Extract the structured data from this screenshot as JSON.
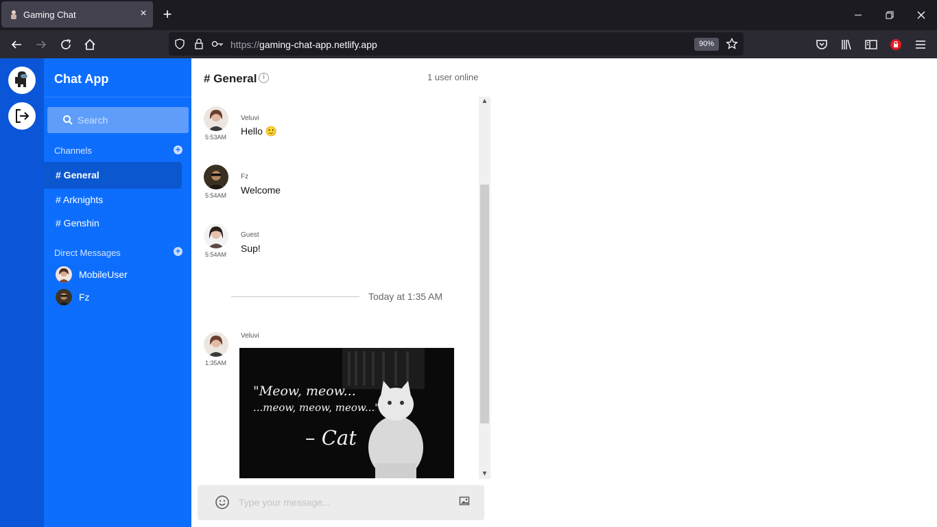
{
  "browser": {
    "tab_title": "Gaming Chat",
    "url_protocol": "https://",
    "url_host": "gaming-chat-app.netlify.app",
    "zoom": "90%"
  },
  "app": {
    "brand": "Chat App",
    "search_placeholder": "Search",
    "channels_title": "Channels",
    "channels": [
      "# General",
      "# Arknights",
      "# Genshin"
    ],
    "active_channel": "# General",
    "dm_title": "Direct Messages",
    "dms": [
      "MobileUser",
      "Fz"
    ]
  },
  "chat": {
    "title": "# General",
    "online": "1 user online",
    "messages": [
      {
        "user": "Veluvi",
        "time": "5:53AM",
        "text": "Hello 🙂"
      },
      {
        "user": "Fz",
        "time": "5:54AM",
        "text": "Welcome"
      },
      {
        "user": "Guest",
        "time": "5:54AM",
        "text": "Sup!"
      },
      {
        "user": "Veluvi",
        "time": "1:35AM",
        "text": ""
      }
    ],
    "divider": "Today at 1:35 AM",
    "image_quote": {
      "line1": "\"Meow, meow...",
      "line2": "...meow, meow, meow...\"",
      "line3": "– Cat"
    },
    "composer_placeholder": "Type your message..."
  },
  "colors": {
    "rail": "#0b55d8",
    "sidebar": "#0d6efd",
    "active_channel": "#0b57d0"
  }
}
